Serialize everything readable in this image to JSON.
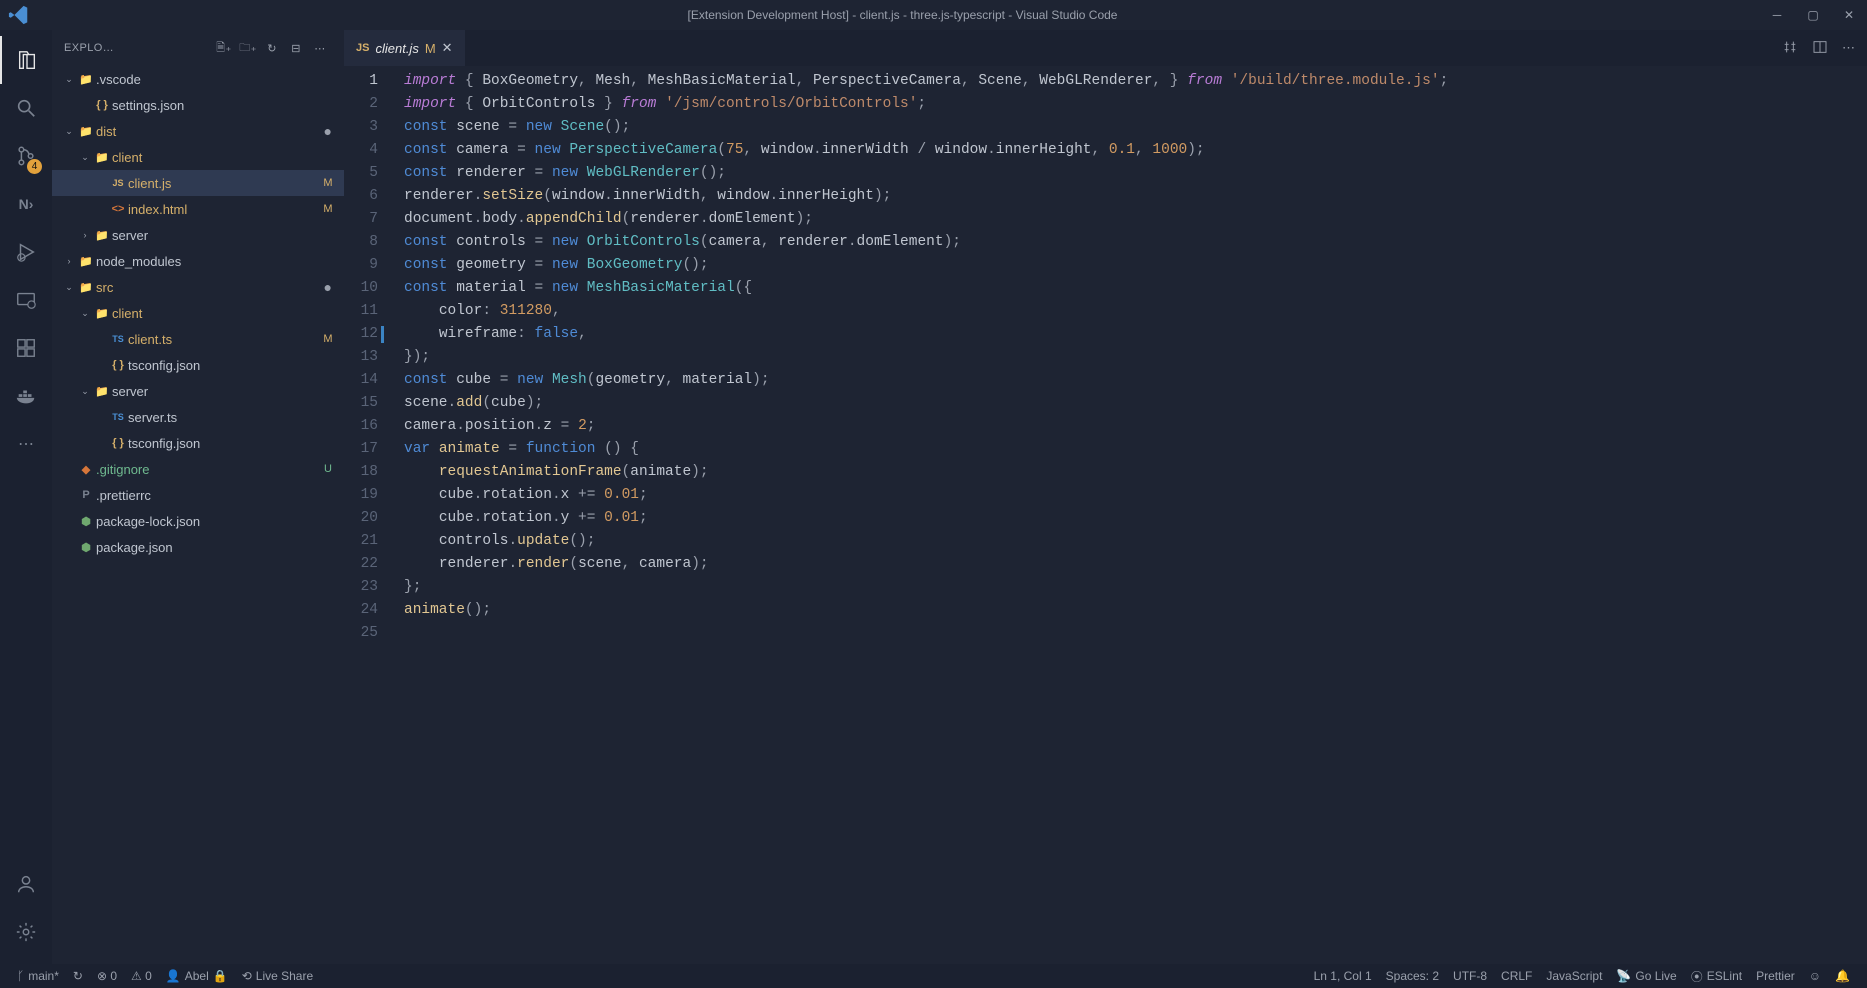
{
  "titlebar": {
    "title": "[Extension Development Host] - client.js - three.js-typescript - Visual Studio Code"
  },
  "activity": {
    "source_control_badge": "4"
  },
  "sidebar": {
    "title": "EXPLO…",
    "tree": [
      {
        "indent": 0,
        "chev": "v",
        "icon": "📁",
        "iconClass": "fold",
        "name": ".vscode",
        "cls": ""
      },
      {
        "indent": 1,
        "chev": "",
        "icon": "{ }",
        "iconClass": "json",
        "name": "settings.json",
        "cls": ""
      },
      {
        "indent": 0,
        "chev": "v",
        "icon": "📁",
        "iconClass": "fold",
        "name": "dist",
        "cls": "mod",
        "dot": true
      },
      {
        "indent": 1,
        "chev": "v",
        "icon": "📁",
        "iconClass": "fold",
        "name": "client",
        "cls": "mod"
      },
      {
        "indent": 2,
        "chev": "",
        "icon": "JS",
        "iconClass": "js",
        "name": "client.js",
        "cls": "mod selected",
        "status": "M"
      },
      {
        "indent": 2,
        "chev": "",
        "icon": "<>",
        "iconClass": "html",
        "name": "index.html",
        "cls": "mod",
        "status": "M"
      },
      {
        "indent": 1,
        "chev": ">",
        "icon": "📁",
        "iconClass": "fold",
        "name": "server",
        "cls": ""
      },
      {
        "indent": 0,
        "chev": ">",
        "icon": "📁",
        "iconClass": "fold-g",
        "name": "node_modules",
        "cls": ""
      },
      {
        "indent": 0,
        "chev": "v",
        "icon": "📁",
        "iconClass": "fold-g",
        "name": "src",
        "cls": "mod",
        "dot": true
      },
      {
        "indent": 1,
        "chev": "v",
        "icon": "📁",
        "iconClass": "fold",
        "name": "client",
        "cls": "mod"
      },
      {
        "indent": 2,
        "chev": "",
        "icon": "TS",
        "iconClass": "ts",
        "name": "client.ts",
        "cls": "mod",
        "status": "M"
      },
      {
        "indent": 2,
        "chev": "",
        "icon": "{ }",
        "iconClass": "json",
        "name": "tsconfig.json",
        "cls": ""
      },
      {
        "indent": 1,
        "chev": "v",
        "icon": "📁",
        "iconClass": "fold",
        "name": "server",
        "cls": ""
      },
      {
        "indent": 2,
        "chev": "",
        "icon": "TS",
        "iconClass": "ts",
        "name": "server.ts",
        "cls": ""
      },
      {
        "indent": 2,
        "chev": "",
        "icon": "{ }",
        "iconClass": "json",
        "name": "tsconfig.json",
        "cls": ""
      },
      {
        "indent": 0,
        "chev": "",
        "icon": "◆",
        "iconClass": "git",
        "name": ".gitignore",
        "cls": "untracked",
        "status": "U"
      },
      {
        "indent": 0,
        "chev": "",
        "icon": "P",
        "iconClass": "pret",
        "name": ".prettierrc",
        "cls": ""
      },
      {
        "indent": 0,
        "chev": "",
        "icon": "⬢",
        "iconClass": "node",
        "name": "package-lock.json",
        "cls": ""
      },
      {
        "indent": 0,
        "chev": "",
        "icon": "⬢",
        "iconClass": "node",
        "name": "package.json",
        "cls": ""
      }
    ]
  },
  "tabs": {
    "active": {
      "icon": "JS",
      "name": "client.js",
      "status": "M"
    }
  },
  "code": {
    "lines": [
      [
        [
          "kw",
          "import"
        ],
        [
          "punc",
          " { "
        ],
        [
          "var",
          "BoxGeometry"
        ],
        [
          "punc",
          ", "
        ],
        [
          "var",
          "Mesh"
        ],
        [
          "punc",
          ", "
        ],
        [
          "var",
          "MeshBasicMaterial"
        ],
        [
          "punc",
          ", "
        ],
        [
          "var",
          "PerspectiveCamera"
        ],
        [
          "punc",
          ", "
        ],
        [
          "var",
          "Scene"
        ],
        [
          "punc",
          ", "
        ],
        [
          "var",
          "WebGLRenderer"
        ],
        [
          "punc",
          ", } "
        ],
        [
          "kw",
          "from"
        ],
        [
          "punc",
          " "
        ],
        [
          "str",
          "'/build/three.module.js'"
        ],
        [
          "punc",
          ";"
        ]
      ],
      [
        [
          "kw",
          "import"
        ],
        [
          "punc",
          " { "
        ],
        [
          "var",
          "OrbitControls"
        ],
        [
          "punc",
          " } "
        ],
        [
          "kw",
          "from"
        ],
        [
          "punc",
          " "
        ],
        [
          "str",
          "'/jsm/controls/OrbitControls'"
        ],
        [
          "punc",
          ";"
        ]
      ],
      [
        [
          "kw2",
          "const"
        ],
        [
          "punc",
          " "
        ],
        [
          "var",
          "scene"
        ],
        [
          "punc",
          " = "
        ],
        [
          "kw2",
          "new"
        ],
        [
          "punc",
          " "
        ],
        [
          "type",
          "Scene"
        ],
        [
          "punc",
          "();"
        ]
      ],
      [
        [
          "kw2",
          "const"
        ],
        [
          "punc",
          " "
        ],
        [
          "var",
          "camera"
        ],
        [
          "punc",
          " = "
        ],
        [
          "kw2",
          "new"
        ],
        [
          "punc",
          " "
        ],
        [
          "type",
          "PerspectiveCamera"
        ],
        [
          "punc",
          "("
        ],
        [
          "num",
          "75"
        ],
        [
          "punc",
          ", "
        ],
        [
          "var",
          "window"
        ],
        [
          "punc",
          "."
        ],
        [
          "prop",
          "innerWidth"
        ],
        [
          "punc",
          " / "
        ],
        [
          "var",
          "window"
        ],
        [
          "punc",
          "."
        ],
        [
          "prop",
          "innerHeight"
        ],
        [
          "punc",
          ", "
        ],
        [
          "num",
          "0.1"
        ],
        [
          "punc",
          ", "
        ],
        [
          "num",
          "1000"
        ],
        [
          "punc",
          ");"
        ]
      ],
      [
        [
          "kw2",
          "const"
        ],
        [
          "punc",
          " "
        ],
        [
          "var",
          "renderer"
        ],
        [
          "punc",
          " = "
        ],
        [
          "kw2",
          "new"
        ],
        [
          "punc",
          " "
        ],
        [
          "type",
          "WebGLRenderer"
        ],
        [
          "punc",
          "();"
        ]
      ],
      [
        [
          "var",
          "renderer"
        ],
        [
          "punc",
          "."
        ],
        [
          "func",
          "setSize"
        ],
        [
          "punc",
          "("
        ],
        [
          "var",
          "window"
        ],
        [
          "punc",
          "."
        ],
        [
          "prop",
          "innerWidth"
        ],
        [
          "punc",
          ", "
        ],
        [
          "var",
          "window"
        ],
        [
          "punc",
          "."
        ],
        [
          "prop",
          "innerHeight"
        ],
        [
          "punc",
          ");"
        ]
      ],
      [
        [
          "var",
          "document"
        ],
        [
          "punc",
          "."
        ],
        [
          "prop",
          "body"
        ],
        [
          "punc",
          "."
        ],
        [
          "func",
          "appendChild"
        ],
        [
          "punc",
          "("
        ],
        [
          "var",
          "renderer"
        ],
        [
          "punc",
          "."
        ],
        [
          "prop",
          "domElement"
        ],
        [
          "punc",
          ");"
        ]
      ],
      [
        [
          "kw2",
          "const"
        ],
        [
          "punc",
          " "
        ],
        [
          "var",
          "controls"
        ],
        [
          "punc",
          " = "
        ],
        [
          "kw2",
          "new"
        ],
        [
          "punc",
          " "
        ],
        [
          "type",
          "OrbitControls"
        ],
        [
          "punc",
          "("
        ],
        [
          "var",
          "camera"
        ],
        [
          "punc",
          ", "
        ],
        [
          "var",
          "renderer"
        ],
        [
          "punc",
          "."
        ],
        [
          "prop",
          "domElement"
        ],
        [
          "punc",
          ");"
        ]
      ],
      [
        [
          "kw2",
          "const"
        ],
        [
          "punc",
          " "
        ],
        [
          "var",
          "geometry"
        ],
        [
          "punc",
          " = "
        ],
        [
          "kw2",
          "new"
        ],
        [
          "punc",
          " "
        ],
        [
          "type",
          "BoxGeometry"
        ],
        [
          "punc",
          "();"
        ]
      ],
      [
        [
          "kw2",
          "const"
        ],
        [
          "punc",
          " "
        ],
        [
          "var",
          "material"
        ],
        [
          "punc",
          " = "
        ],
        [
          "kw2",
          "new"
        ],
        [
          "punc",
          " "
        ],
        [
          "type",
          "MeshBasicMaterial"
        ],
        [
          "punc",
          "({"
        ]
      ],
      [
        [
          "punc",
          "    "
        ],
        [
          "prop",
          "color"
        ],
        [
          "punc",
          ": "
        ],
        [
          "num",
          "311280"
        ],
        [
          "punc",
          ","
        ]
      ],
      [
        [
          "punc",
          "    "
        ],
        [
          "prop",
          "wireframe"
        ],
        [
          "punc",
          ": "
        ],
        [
          "bool",
          "false"
        ],
        [
          "punc",
          ","
        ]
      ],
      [
        [
          "punc",
          "});"
        ]
      ],
      [
        [
          "kw2",
          "const"
        ],
        [
          "punc",
          " "
        ],
        [
          "var",
          "cube"
        ],
        [
          "punc",
          " = "
        ],
        [
          "kw2",
          "new"
        ],
        [
          "punc",
          " "
        ],
        [
          "type",
          "Mesh"
        ],
        [
          "punc",
          "("
        ],
        [
          "var",
          "geometry"
        ],
        [
          "punc",
          ", "
        ],
        [
          "var",
          "material"
        ],
        [
          "punc",
          ");"
        ]
      ],
      [
        [
          "var",
          "scene"
        ],
        [
          "punc",
          "."
        ],
        [
          "func",
          "add"
        ],
        [
          "punc",
          "("
        ],
        [
          "var",
          "cube"
        ],
        [
          "punc",
          ");"
        ]
      ],
      [
        [
          "var",
          "camera"
        ],
        [
          "punc",
          "."
        ],
        [
          "prop",
          "position"
        ],
        [
          "punc",
          "."
        ],
        [
          "prop",
          "z"
        ],
        [
          "punc",
          " = "
        ],
        [
          "num",
          "2"
        ],
        [
          "punc",
          ";"
        ]
      ],
      [
        [
          "kw2",
          "var"
        ],
        [
          "punc",
          " "
        ],
        [
          "func",
          "animate"
        ],
        [
          "punc",
          " = "
        ],
        [
          "kw2",
          "function"
        ],
        [
          "punc",
          " () {"
        ]
      ],
      [
        [
          "punc",
          "    "
        ],
        [
          "func",
          "requestAnimationFrame"
        ],
        [
          "punc",
          "("
        ],
        [
          "var",
          "animate"
        ],
        [
          "punc",
          ");"
        ]
      ],
      [
        [
          "punc",
          "    "
        ],
        [
          "var",
          "cube"
        ],
        [
          "punc",
          "."
        ],
        [
          "prop",
          "rotation"
        ],
        [
          "punc",
          "."
        ],
        [
          "prop",
          "x"
        ],
        [
          "punc",
          " += "
        ],
        [
          "num",
          "0.01"
        ],
        [
          "punc",
          ";"
        ]
      ],
      [
        [
          "punc",
          "    "
        ],
        [
          "var",
          "cube"
        ],
        [
          "punc",
          "."
        ],
        [
          "prop",
          "rotation"
        ],
        [
          "punc",
          "."
        ],
        [
          "prop",
          "y"
        ],
        [
          "punc",
          " += "
        ],
        [
          "num",
          "0.01"
        ],
        [
          "punc",
          ";"
        ]
      ],
      [
        [
          "punc",
          "    "
        ],
        [
          "var",
          "controls"
        ],
        [
          "punc",
          "."
        ],
        [
          "func",
          "update"
        ],
        [
          "punc",
          "();"
        ]
      ],
      [
        [
          "punc",
          "    "
        ],
        [
          "var",
          "renderer"
        ],
        [
          "punc",
          "."
        ],
        [
          "func",
          "render"
        ],
        [
          "punc",
          "("
        ],
        [
          "var",
          "scene"
        ],
        [
          "punc",
          ", "
        ],
        [
          "var",
          "camera"
        ],
        [
          "punc",
          ");"
        ]
      ],
      [
        [
          "punc",
          "};"
        ]
      ],
      [
        [
          "func",
          "animate"
        ],
        [
          "punc",
          "();"
        ]
      ],
      [
        [
          "punc",
          ""
        ]
      ]
    ]
  },
  "status": {
    "branch": "main*",
    "sync": "↻",
    "errors": "⊗ 0",
    "warnings": "⚠ 0",
    "abel": "Abel",
    "live_share": "Live Share",
    "position": "Ln 1, Col 1",
    "spaces": "Spaces: 2",
    "encoding": "UTF-8",
    "eol": "CRLF",
    "language": "JavaScript",
    "go_live": "Go Live",
    "eslint": "ESLint",
    "prettier": "Prettier"
  }
}
